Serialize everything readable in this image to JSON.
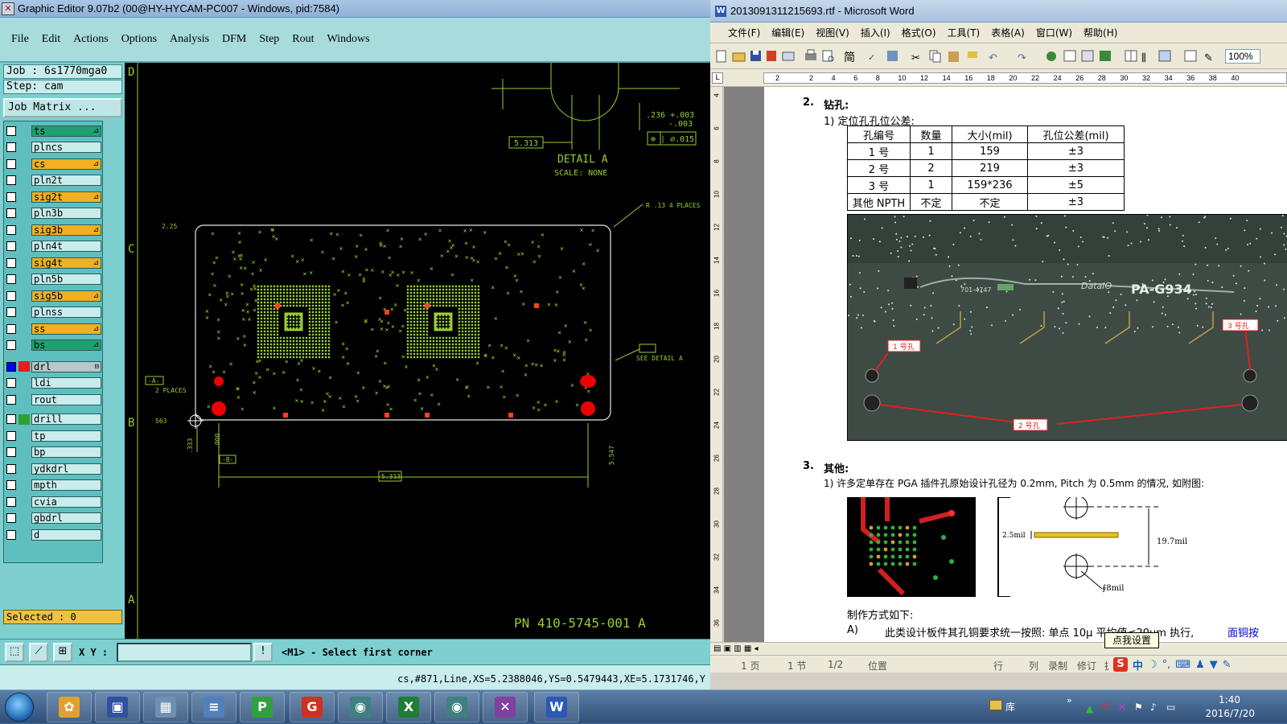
{
  "graphic_editor": {
    "title": "Graphic Editor 9.07b2 (00@HY-HYCAM-PC007 - Windows, pid:7584)",
    "menu": [
      "File",
      "Edit",
      "Actions",
      "Options",
      "Analysis",
      "DFM",
      "Step",
      "Rout",
      "Windows"
    ],
    "job_label": "Job  : 6s1770mga0",
    "step_label": "Step: cam",
    "job_matrix_label": "Job Matrix ...",
    "layers": [
      {
        "name": "ts",
        "color": "#20a070",
        "tag": "⊿",
        "active": false
      },
      {
        "name": "plncs",
        "color": "#c9eded",
        "tag": "",
        "active": false
      },
      {
        "name": "cs",
        "color": "#f0b020",
        "tag": "⊿",
        "active": false
      },
      {
        "name": "pln2t",
        "color": "#c9eded",
        "tag": "",
        "active": false
      },
      {
        "name": "sig2t",
        "color": "#f0b020",
        "tag": "⊿",
        "active": false
      },
      {
        "name": "pln3b",
        "color": "#c9eded",
        "tag": "",
        "active": false
      },
      {
        "name": "sig3b",
        "color": "#f0b020",
        "tag": "⊿",
        "active": false
      },
      {
        "name": "pln4t",
        "color": "#c9eded",
        "tag": "",
        "active": false
      },
      {
        "name": "sig4t",
        "color": "#f0b020",
        "tag": "⊿",
        "active": false
      },
      {
        "name": "pln5b",
        "color": "#c9eded",
        "tag": "",
        "active": false
      },
      {
        "name": "sig5b",
        "color": "#f0b020",
        "tag": "⊿",
        "active": false
      },
      {
        "name": "plnss",
        "color": "#c9eded",
        "tag": "",
        "active": false
      },
      {
        "name": "ss",
        "color": "#f0b020",
        "tag": "⊿",
        "active": false
      },
      {
        "name": "bs",
        "color": "#20a070",
        "tag": "⊿",
        "active": false
      },
      {
        "name": "drl",
        "color": "#b8c8c8",
        "tag": "⊟",
        "active": true
      },
      {
        "name": "ldi",
        "color": "#c9eded",
        "tag": "",
        "active": false
      },
      {
        "name": "rout",
        "color": "#c9eded",
        "tag": "",
        "active": false
      },
      {
        "name": "drill",
        "color": "#c9eded",
        "tag": "",
        "active": false
      },
      {
        "name": "tp",
        "color": "#c9eded",
        "tag": "",
        "active": false
      },
      {
        "name": "bp",
        "color": "#c9eded",
        "tag": "",
        "active": false
      },
      {
        "name": "ydkdrl",
        "color": "#c9eded",
        "tag": "",
        "active": false
      },
      {
        "name": "mpth",
        "color": "#c9eded",
        "tag": "",
        "active": false
      },
      {
        "name": "cvia",
        "color": "#c9eded",
        "tag": "",
        "active": false
      },
      {
        "name": "gbdrl",
        "color": "#c9eded",
        "tag": "",
        "active": false
      },
      {
        "name": "d",
        "color": "#c9eded",
        "tag": "",
        "active": false
      }
    ],
    "selected_label": "Selected : 0",
    "xy_label": "X Y :",
    "xy_value": "",
    "prompt": "<M1> - Select first corner",
    "status_line": "cs,#871,Line,XS=5.2388046,YS=0.5479443,XE=5.1731746,Y",
    "canvas": {
      "zone_letters": [
        "D",
        "C",
        "B",
        "A"
      ],
      "detail_title": "DETAIL  A",
      "detail_scale": "SCALE: NONE",
      "dim_5313_top": "5.313",
      "dim_236": ".236 +.003",
      "dim_236_tol": "-.003",
      "tolerance_box": "⊕ | ∅.015",
      "r_note": "R .13  4 PLACES",
      "see_detail": "SEE DETAIL A",
      "dim_225": "2.25",
      "a_ref": "-A-",
      "two_places": "2 PLACES",
      "dim_563": "563",
      "dim_333": ".333",
      "dim_000": ".000",
      "b_ref": "-B-",
      "dim_5313_bottom": "5.313",
      "dim_5547": "5.547",
      "pn_text": "PN 410-5745-001  A"
    }
  },
  "word": {
    "title": "2013091311215693.rtf - Microsoft Word",
    "menu": [
      "文件(F)",
      "编辑(E)",
      "视图(V)",
      "插入(I)",
      "格式(O)",
      "工具(T)",
      "表格(A)",
      "窗口(W)",
      "帮助(H)"
    ],
    "zoom": "100%",
    "ruler_marks": [
      "2",
      "2",
      "4",
      "6",
      "8",
      "10",
      "12",
      "14",
      "16",
      "18",
      "20",
      "22",
      "24",
      "26",
      "28",
      "30",
      "32",
      "34",
      "36",
      "38",
      "40"
    ],
    "vruler_marks": [
      "4",
      "6",
      "8",
      "10",
      "12",
      "14",
      "16",
      "18",
      "20",
      "22",
      "24",
      "26",
      "28",
      "30",
      "32",
      "34",
      "36"
    ],
    "doc": {
      "section2_num": "2.",
      "section2_title": "钻孔:",
      "item1": "1)  定位孔孔位公差:",
      "table_header": [
        "孔编号",
        "数量",
        "大小(mil)",
        "孔位公差(mil)"
      ],
      "table_rows": [
        [
          "1 号",
          "1",
          "159",
          "±3"
        ],
        [
          "2 号",
          "2",
          "219",
          "±3"
        ],
        [
          "3 号",
          "1",
          "159*236",
          "±5"
        ],
        [
          "其他 NPTH",
          "不定",
          "不定",
          "±3"
        ]
      ],
      "photo_labels": {
        "label1": "1 号孔",
        "label2": "2 号孔",
        "label3": "3 号孔",
        "part_no": "701-4747",
        "brand": "DataIO",
        "model": "PA-G934"
      },
      "section3_num": "3.",
      "section3_title": "其他:",
      "item3_1": "1)  许多定单存在 PGA 插件孔原始设计孔径为 0.2mm, Pitch 为 0.5mm 的情况, 如附图:",
      "diagram_25mil": "2.5mil",
      "diagram_197mil": "19.7mil",
      "diagram_8mil": "∮8mil",
      "making_method": "制作方式如下:",
      "item_a_label": "A)",
      "item_a": "此类设计板件其孔铜要求统一按照: 单点 10μ     平均值≤20μm 执行,",
      "item_a_link": "面铜按"
    },
    "status": {
      "page": "1 页",
      "section": "1 节",
      "pages": "1/2",
      "position": "位置",
      "line": "行",
      "col": "列",
      "rec": "录制",
      "trk": "修订",
      "ext": "扩展"
    },
    "tooltip": "点我设置",
    "ime_text": "中"
  },
  "taskbar": {
    "apps": [
      {
        "name": "shell-icon",
        "color": "#e0a030",
        "glyph": "✿"
      },
      {
        "name": "save-disk-icon",
        "color": "#3050a0",
        "glyph": "▣"
      },
      {
        "name": "calculator-icon",
        "color": "#7090b0",
        "glyph": "▦"
      },
      {
        "name": "notepad-icon",
        "color": "#5080c0",
        "glyph": "≡"
      },
      {
        "name": "p-app-icon",
        "color": "#30a040",
        "glyph": "P"
      },
      {
        "name": "g-app-icon",
        "color": "#d03020",
        "glyph": "G"
      },
      {
        "name": "eye-app-icon",
        "color": "#408080",
        "glyph": "◉"
      },
      {
        "name": "excel-icon",
        "color": "#1e7e34",
        "glyph": "X"
      },
      {
        "name": "eye-app2-icon",
        "color": "#408080",
        "glyph": "◉"
      },
      {
        "name": "x-app-icon",
        "color": "#8040a0",
        "glyph": "✕"
      },
      {
        "name": "word-icon",
        "color": "#2b57b7",
        "glyph": "W"
      }
    ],
    "library_label": "库",
    "clock_time": "1:40",
    "clock_date": "2016/7/20"
  }
}
